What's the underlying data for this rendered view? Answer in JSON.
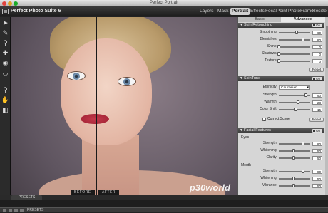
{
  "window": {
    "title": "Perfect Portrait"
  },
  "app": {
    "name": "Perfect Photo Suite 6",
    "tabs": [
      {
        "label": "Layers"
      },
      {
        "label": "Mask"
      },
      {
        "label": "Portrait",
        "active": true
      },
      {
        "label": "Effects"
      },
      {
        "label": "FocalPoint"
      },
      {
        "label": "PhotoFrame"
      },
      {
        "label": "Resize"
      }
    ]
  },
  "tools": [
    "arrow-icon",
    "brush-icon",
    "eyedropper-icon",
    "clone-icon",
    "eye-icon",
    "mouth-icon",
    "zoom-icon",
    "hand-icon",
    "compare-icon"
  ],
  "canvas": {
    "before_label": "BEFORE",
    "after_label": "AFTER",
    "watermark": "p30world"
  },
  "panel": {
    "mode_tabs": [
      {
        "label": "Basic"
      },
      {
        "label": "Advanced",
        "active": true
      }
    ],
    "skin_retouching": {
      "title": "Skin Retouching",
      "toggle": "On",
      "rows": [
        {
          "label": "Smoothing:",
          "value": "60",
          "level": 0.6
        },
        {
          "label": "Blemishes:",
          "value": "80",
          "level": 0.8
        },
        {
          "label": "Shine:",
          "value": "0",
          "level": 0.0
        },
        {
          "label": "Shadows:",
          "value": "0",
          "level": 0.0
        },
        {
          "label": "Texture:",
          "value": "0",
          "level": 0.0
        }
      ],
      "reset": "Reset"
    },
    "skintune": {
      "title": "SkinTune",
      "toggle": "On",
      "ethnicity_label": "Ethnicity:",
      "ethnicity_value": "Caucasian",
      "rows": [
        {
          "label": "Strength:",
          "value": "90",
          "level": 0.9
        },
        {
          "label": "Warmth:",
          "value": "28",
          "level": 0.64
        },
        {
          "label": "Color Shift:",
          "value": "15",
          "level": 0.57
        }
      ],
      "correct_scene": "Correct Scene",
      "reset": "Reset"
    },
    "facial_features": {
      "title": "Facial Features",
      "toggle": "On",
      "eyes_label": "Eyes",
      "eyes_rows": [
        {
          "label": "Strength:",
          "value": "80",
          "level": 0.8
        },
        {
          "label": "Whitening:",
          "value": "50",
          "level": 0.5
        },
        {
          "label": "Clarity:",
          "value": "50",
          "level": 0.5
        }
      ],
      "mouth_label": "Mouth",
      "mouth_rows": [
        {
          "label": "Strength:",
          "value": "80",
          "level": 0.8
        },
        {
          "label": "Whitening:",
          "value": "50",
          "level": 0.5
        },
        {
          "label": "Vibrance:",
          "value": "50",
          "level": 0.5
        }
      ]
    }
  },
  "presets": {
    "tab_label": "PRESETS",
    "status_label": "PRESETS"
  }
}
